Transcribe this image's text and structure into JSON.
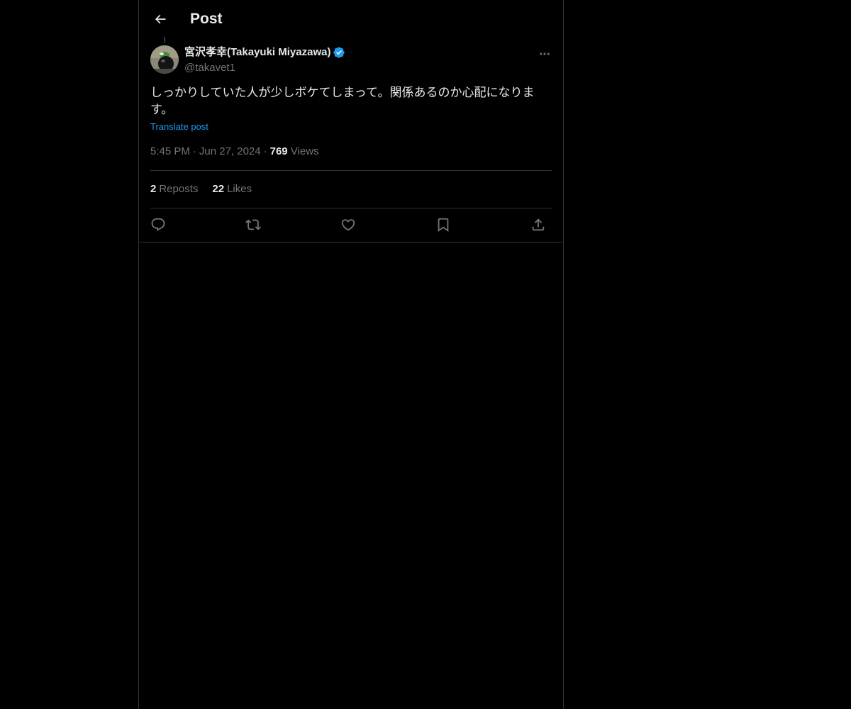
{
  "header": {
    "title": "Post",
    "back_icon": "arrow-left-icon"
  },
  "post": {
    "author": {
      "display_name": "宮沢孝幸(Takayuki Miyazawa)",
      "handle": "@takavet1",
      "verified": true
    },
    "text": "しっかりしていた人が少しボケてしまって。関係あるのか心配になります。",
    "translate_label": "Translate post",
    "time": "5:45 PM",
    "date": "Jun 27, 2024",
    "views_count": "769",
    "views_label": "Views",
    "separator": "·",
    "reposts_count": "2",
    "reposts_label": "Reposts",
    "likes_count": "22",
    "likes_label": "Likes"
  },
  "actions": [
    {
      "icon": "reply-icon"
    },
    {
      "icon": "repost-icon"
    },
    {
      "icon": "like-icon"
    },
    {
      "icon": "bookmark-icon"
    },
    {
      "icon": "share-icon"
    }
  ],
  "colors": {
    "background": "#000000",
    "text": "#e7e9ea",
    "secondary": "#71767b",
    "accent": "#1d9bf0",
    "border": "#2f3336"
  }
}
